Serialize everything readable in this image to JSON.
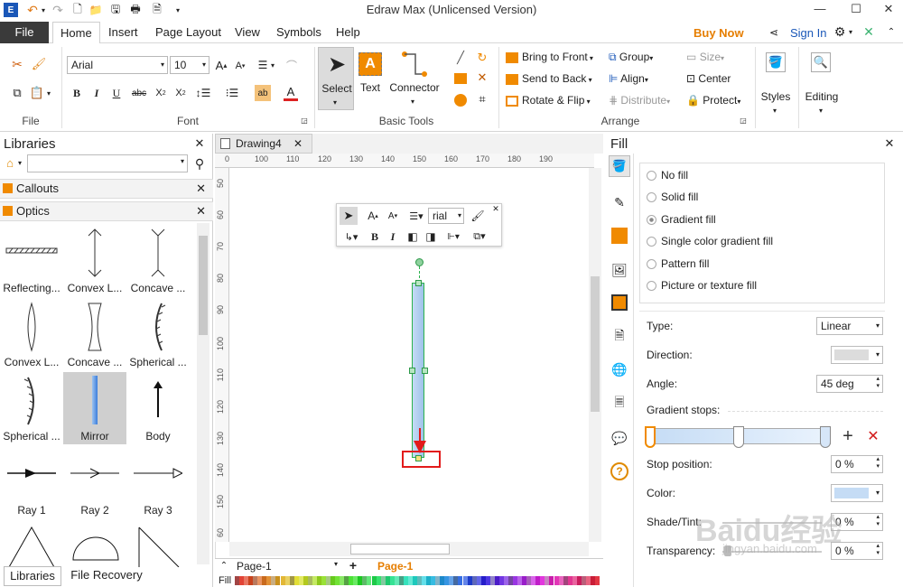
{
  "app": {
    "title": "Edraw Max (Unlicensed Version)"
  },
  "topbar": {
    "buy_now": "Buy Now",
    "sign_in": "Sign In"
  },
  "tabs": [
    "File",
    "Home",
    "Insert",
    "Page Layout",
    "View",
    "Symbols",
    "Help"
  ],
  "ribbon": {
    "font_name": "Arial",
    "font_size": "10",
    "groups": {
      "file": "File",
      "font": "Font",
      "basic_tools": "Basic Tools",
      "arrange": "Arrange"
    },
    "tools": {
      "select": "Select",
      "text": "Text",
      "connector": "Connector"
    },
    "arrange": {
      "bring_to_front": "Bring to Front",
      "send_to_back": "Send to Back",
      "rotate_flip": "Rotate & Flip",
      "group": "Group",
      "align": "Align",
      "distribute": "Distribute",
      "size": "Size",
      "center": "Center",
      "protect": "Protect"
    },
    "styles": "Styles",
    "editing": "Editing"
  },
  "libraries": {
    "title": "Libraries",
    "sections": [
      "Callouts",
      "Optics"
    ],
    "shapes": [
      {
        "label": "Reflecting..."
      },
      {
        "label": "Convex L..."
      },
      {
        "label": "Concave ..."
      },
      {
        "label": "Convex L..."
      },
      {
        "label": "Concave ..."
      },
      {
        "label": "Spherical ..."
      },
      {
        "label": "Spherical ..."
      },
      {
        "label": "Mirror"
      },
      {
        "label": "Body"
      },
      {
        "label": "Ray 1"
      },
      {
        "label": "Ray 2"
      },
      {
        "label": "Ray 3"
      }
    ],
    "bottom_tabs": [
      "Libraries",
      "File Recovery"
    ]
  },
  "document": {
    "tab": "Drawing4",
    "hruler": [
      "0",
      "100",
      "110",
      "120",
      "130",
      "140",
      "150",
      "160",
      "170",
      "180",
      "190"
    ],
    "vruler": [
      "50",
      "60",
      "70",
      "80",
      "90",
      "100",
      "110",
      "120",
      "130",
      "140",
      "150",
      "60"
    ],
    "mini_font": "rial",
    "page_selector": "Page-1",
    "page_tab": "Page-1",
    "fill_label": "Fill"
  },
  "fill": {
    "title": "Fill",
    "options": [
      "No fill",
      "Solid fill",
      "Gradient fill",
      "Single color gradient fill",
      "Pattern fill",
      "Picture or texture fill"
    ],
    "type_label": "Type:",
    "type_value": "Linear",
    "direction_label": "Direction:",
    "angle_label": "Angle:",
    "angle_value": "45 deg",
    "stops_label": "Gradient stops:",
    "stop_pos_label": "Stop position:",
    "stop_pos_value": "0 %",
    "color_label": "Color:",
    "shade_label": "Shade/Tint:",
    "shade_value": "0 %",
    "transparency_label": "Transparency:",
    "transparency_value": "0 %",
    "stop_color": "#c5dcf5"
  },
  "watermark": {
    "brand": "Baidu经验",
    "url": "jingyan.baidu.com"
  }
}
